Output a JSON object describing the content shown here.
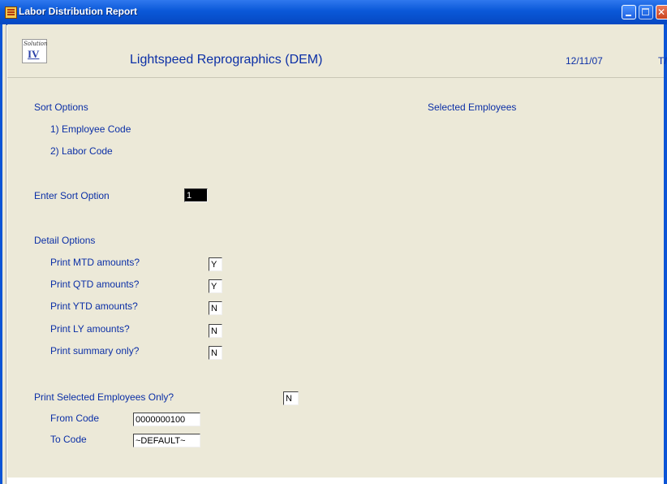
{
  "window": {
    "title": "Labor Distribution Report",
    "colors": {
      "titlebar": "#0a58d8",
      "label_text": "#0b2fa6",
      "background": "#ece9d8"
    }
  },
  "header": {
    "logo_script": "Solution",
    "logo_numeral": "IV",
    "company": "Lightspeed Reprographics (DEM)",
    "date": "12/11/07",
    "extra": "T/"
  },
  "sort": {
    "heading": "Sort Options",
    "option1": "1) Employee Code",
    "option2": "2) Labor Code",
    "enter_label": "Enter Sort Option",
    "enter_value": "1"
  },
  "selected_employees_heading": "Selected Employees",
  "detail": {
    "heading": "Detail Options",
    "items": [
      {
        "label": "Print MTD amounts?",
        "value": "Y"
      },
      {
        "label": "Print QTD amounts?",
        "value": "Y"
      },
      {
        "label": "Print YTD amounts?",
        "value": "N"
      },
      {
        "label": "Print LY amounts?",
        "value": "N"
      },
      {
        "label": "Print summary only?",
        "value": "N"
      }
    ]
  },
  "selection": {
    "label": "Print Selected Employees Only?",
    "value": "N",
    "from_label": "From Code",
    "from_value": "0000000100",
    "to_label": "To Code",
    "to_value": "~DEFAULT~"
  }
}
